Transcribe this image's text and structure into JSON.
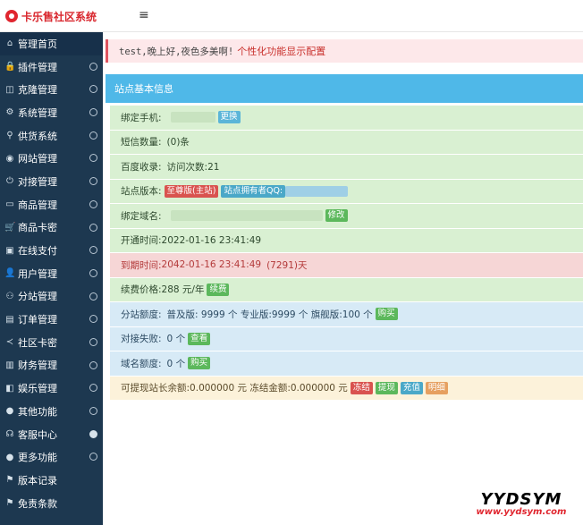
{
  "app": {
    "title": "卡乐售社区系统",
    "menu_toggle": "≡"
  },
  "sidebar": {
    "items": [
      {
        "label": "管理首页",
        "icon": "home-icon",
        "glyph": "⌂",
        "arrow": ""
      },
      {
        "label": "插件管理",
        "icon": "lock-icon",
        "glyph": "🔒",
        "arrow": "⊖"
      },
      {
        "label": "克隆管理",
        "icon": "clone-icon",
        "glyph": "◫",
        "arrow": "⊖"
      },
      {
        "label": "系统管理",
        "icon": "gear-icon",
        "glyph": "⚙",
        "arrow": "⊖"
      },
      {
        "label": "供货系统",
        "icon": "supply-icon",
        "glyph": "⚲",
        "arrow": "⊖"
      },
      {
        "label": "网站管理",
        "icon": "globe-icon",
        "glyph": "◉",
        "arrow": "⊖"
      },
      {
        "label": "对接管理",
        "icon": "power-icon",
        "glyph": "⏻",
        "arrow": "⊖"
      },
      {
        "label": "商品管理",
        "icon": "box-icon",
        "glyph": "▭",
        "arrow": "⊖"
      },
      {
        "label": "商品卡密",
        "icon": "cart-icon",
        "glyph": "🛒",
        "arrow": "⊖"
      },
      {
        "label": "在线支付",
        "icon": "pay-icon",
        "glyph": "▣",
        "arrow": "⊖"
      },
      {
        "label": "用户管理",
        "icon": "user-icon",
        "glyph": "👤",
        "arrow": "⊖"
      },
      {
        "label": "分站管理",
        "icon": "sitemap-icon",
        "glyph": "⚇",
        "arrow": "⊖"
      },
      {
        "label": "订单管理",
        "icon": "order-icon",
        "glyph": "▤",
        "arrow": "⊖"
      },
      {
        "label": "社区卡密",
        "icon": "share-icon",
        "glyph": "≺",
        "arrow": "⊖"
      },
      {
        "label": "财务管理",
        "icon": "chart-icon",
        "glyph": "▥",
        "arrow": "⊖"
      },
      {
        "label": "娱乐管理",
        "icon": "game-icon",
        "glyph": "◧",
        "arrow": "⊖"
      },
      {
        "label": "其他功能",
        "icon": "apple-icon",
        "glyph": "●",
        "arrow": "⊖"
      },
      {
        "label": "客服中心",
        "icon": "support-icon",
        "glyph": "☊",
        "arrow": "●"
      },
      {
        "label": "更多功能",
        "icon": "apple-icon",
        "glyph": "●",
        "arrow": "⊖"
      },
      {
        "label": "版本记录",
        "icon": "tag-icon",
        "glyph": "⚑",
        "arrow": ""
      },
      {
        "label": "免责条款",
        "icon": "tag-icon",
        "glyph": "⚑",
        "arrow": ""
      }
    ]
  },
  "alert": {
    "text": "test,晚上好,夜色多美啊!",
    "link": "个性化功能显示配置"
  },
  "panel": {
    "title": "站点基本信息"
  },
  "rows": {
    "bind_phone": {
      "label": "绑定手机:",
      "btn": "更换"
    },
    "sms": {
      "label": "短信数量:",
      "value": "(0)条"
    },
    "baidu": {
      "label": "百度收录:",
      "value": "访问次数:21"
    },
    "version": {
      "label": "站点版本:",
      "tag1": "至尊版(主站)",
      "tag2": "站点拥有者QQ:"
    },
    "domain": {
      "label": "绑定域名:",
      "btn": "修改"
    },
    "open_time": {
      "label": "开通时间:",
      "value": "2022-01-16 23:41:49"
    },
    "expire": {
      "label": "到期时间:",
      "value": "2042-01-16 23:41:49",
      "days": "(7291)天"
    },
    "renew": {
      "label": "续费价格:",
      "value": "288 元/年",
      "btn": "续费"
    },
    "quota": {
      "label": "分站额度:",
      "value": "普及版: 9999 个 专业版:9999 个 旗舰版:100 个",
      "btn": "购买"
    },
    "dock_fail": {
      "label": "对接失败:",
      "value": "0 个",
      "btn": "查看"
    },
    "domain_quota": {
      "label": "域名额度:",
      "value": "0 个",
      "btn": "购买"
    },
    "balance": {
      "label": "可提现站长余额:",
      "value": "0.000000 元 冻结金额:0.000000 元",
      "btn1": "冻结",
      "btn2": "提现",
      "btn3": "充值",
      "btn4": "明细"
    }
  },
  "watermark": {
    "main": "YYDSYM",
    "url": "www.yydsym.com"
  }
}
